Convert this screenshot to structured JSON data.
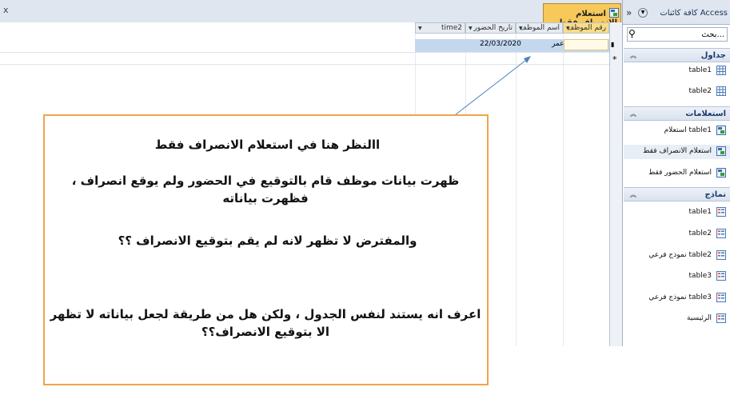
{
  "window": {
    "close_glyph": "x"
  },
  "tab": {
    "label": "استعلام الانصراف فقط"
  },
  "datasheet": {
    "columns": [
      "رقم الموظف",
      "اسم الموظف",
      "تاريخ الحضور",
      "time2"
    ],
    "row": {
      "date": "22/03/2020",
      "name": "عمر"
    },
    "new_row_marker": "*"
  },
  "nav": {
    "title": "كافة كائنات Access",
    "search_placeholder": "بحث...",
    "groups": [
      {
        "label": "جداول",
        "items": [
          "table1",
          "table2"
        ]
      },
      {
        "label": "استعلامات",
        "items": [
          "table1 استعلام",
          "استعلام الانصراف فقط",
          "استعلام الحضور فقط"
        ]
      },
      {
        "label": "نماذج",
        "items": [
          "table1",
          "table2",
          "table2 نموذج فرعي",
          "table3",
          "table3 نموذج فرعي",
          "الرئيسية"
        ]
      }
    ]
  },
  "callout": {
    "line1": "االنظر هنا في استعلام الانصراف فقط",
    "line2": "ظهرت بيانات موظف قام بالتوقيع في الحضور ولم يوقع انصراف ، فظهرت بياناته",
    "line3": "والمفترض لا تظهر لانه لم يقم بتوقيع الانصراف ؟؟",
    "line4": "اعرف انه يستند لنفس الجدول ، ولكن هل من طريقة لجعل بياناته لا تظهر الا بتوقيع الانصراف؟؟"
  },
  "colors": {
    "tab": "#f7c85a",
    "callout_border": "#f2a34b",
    "selected_row": "#c3d8ef",
    "arrow": "#4f81bd"
  }
}
